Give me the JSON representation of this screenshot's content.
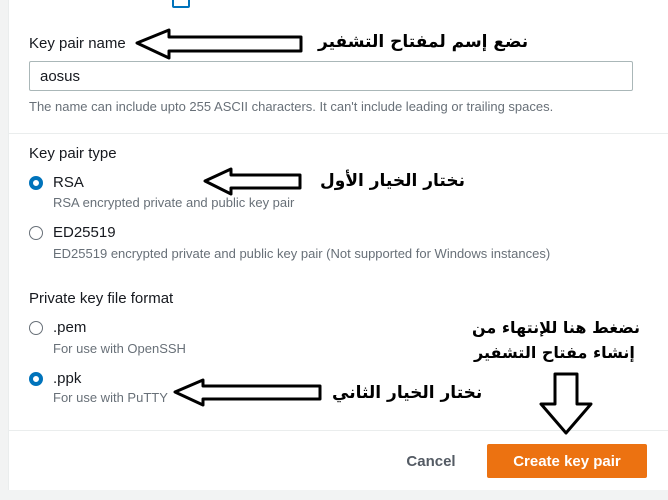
{
  "key_pair_name": {
    "label": "Key pair name",
    "value": "aosus",
    "hint": "The name can include upto 255 ASCII characters. It can't include leading or trailing spaces."
  },
  "key_pair_type": {
    "label": "Key pair type",
    "options": [
      {
        "label": "RSA",
        "description": "RSA encrypted private and public key pair",
        "selected": true
      },
      {
        "label": "ED25519",
        "description": "ED25519 encrypted private and public key pair (Not supported for Windows instances)",
        "selected": false
      }
    ]
  },
  "private_key_format": {
    "label": "Private key file format",
    "options": [
      {
        "label": ".pem",
        "description": "For use with OpenSSH",
        "selected": false
      },
      {
        "label": ".ppk",
        "description": "For use with PuTTY",
        "selected": true
      }
    ]
  },
  "footer": {
    "cancel_label": "Cancel",
    "create_label": "Create key pair"
  },
  "annotations": {
    "name_note": "نضع إسم لمفتاح التشفير",
    "type_note": "نختار الخيار الأول",
    "create_note_line1": "نضغط هنا للإنتهاء من",
    "create_note_line2": "إنشاء مفتاح التشفير",
    "format_note": "نختار الخيار الثاني"
  },
  "colors": {
    "accent": "#0073bb",
    "primary_button": "#ec7211",
    "text": "#16191f",
    "muted_text": "#687078"
  }
}
